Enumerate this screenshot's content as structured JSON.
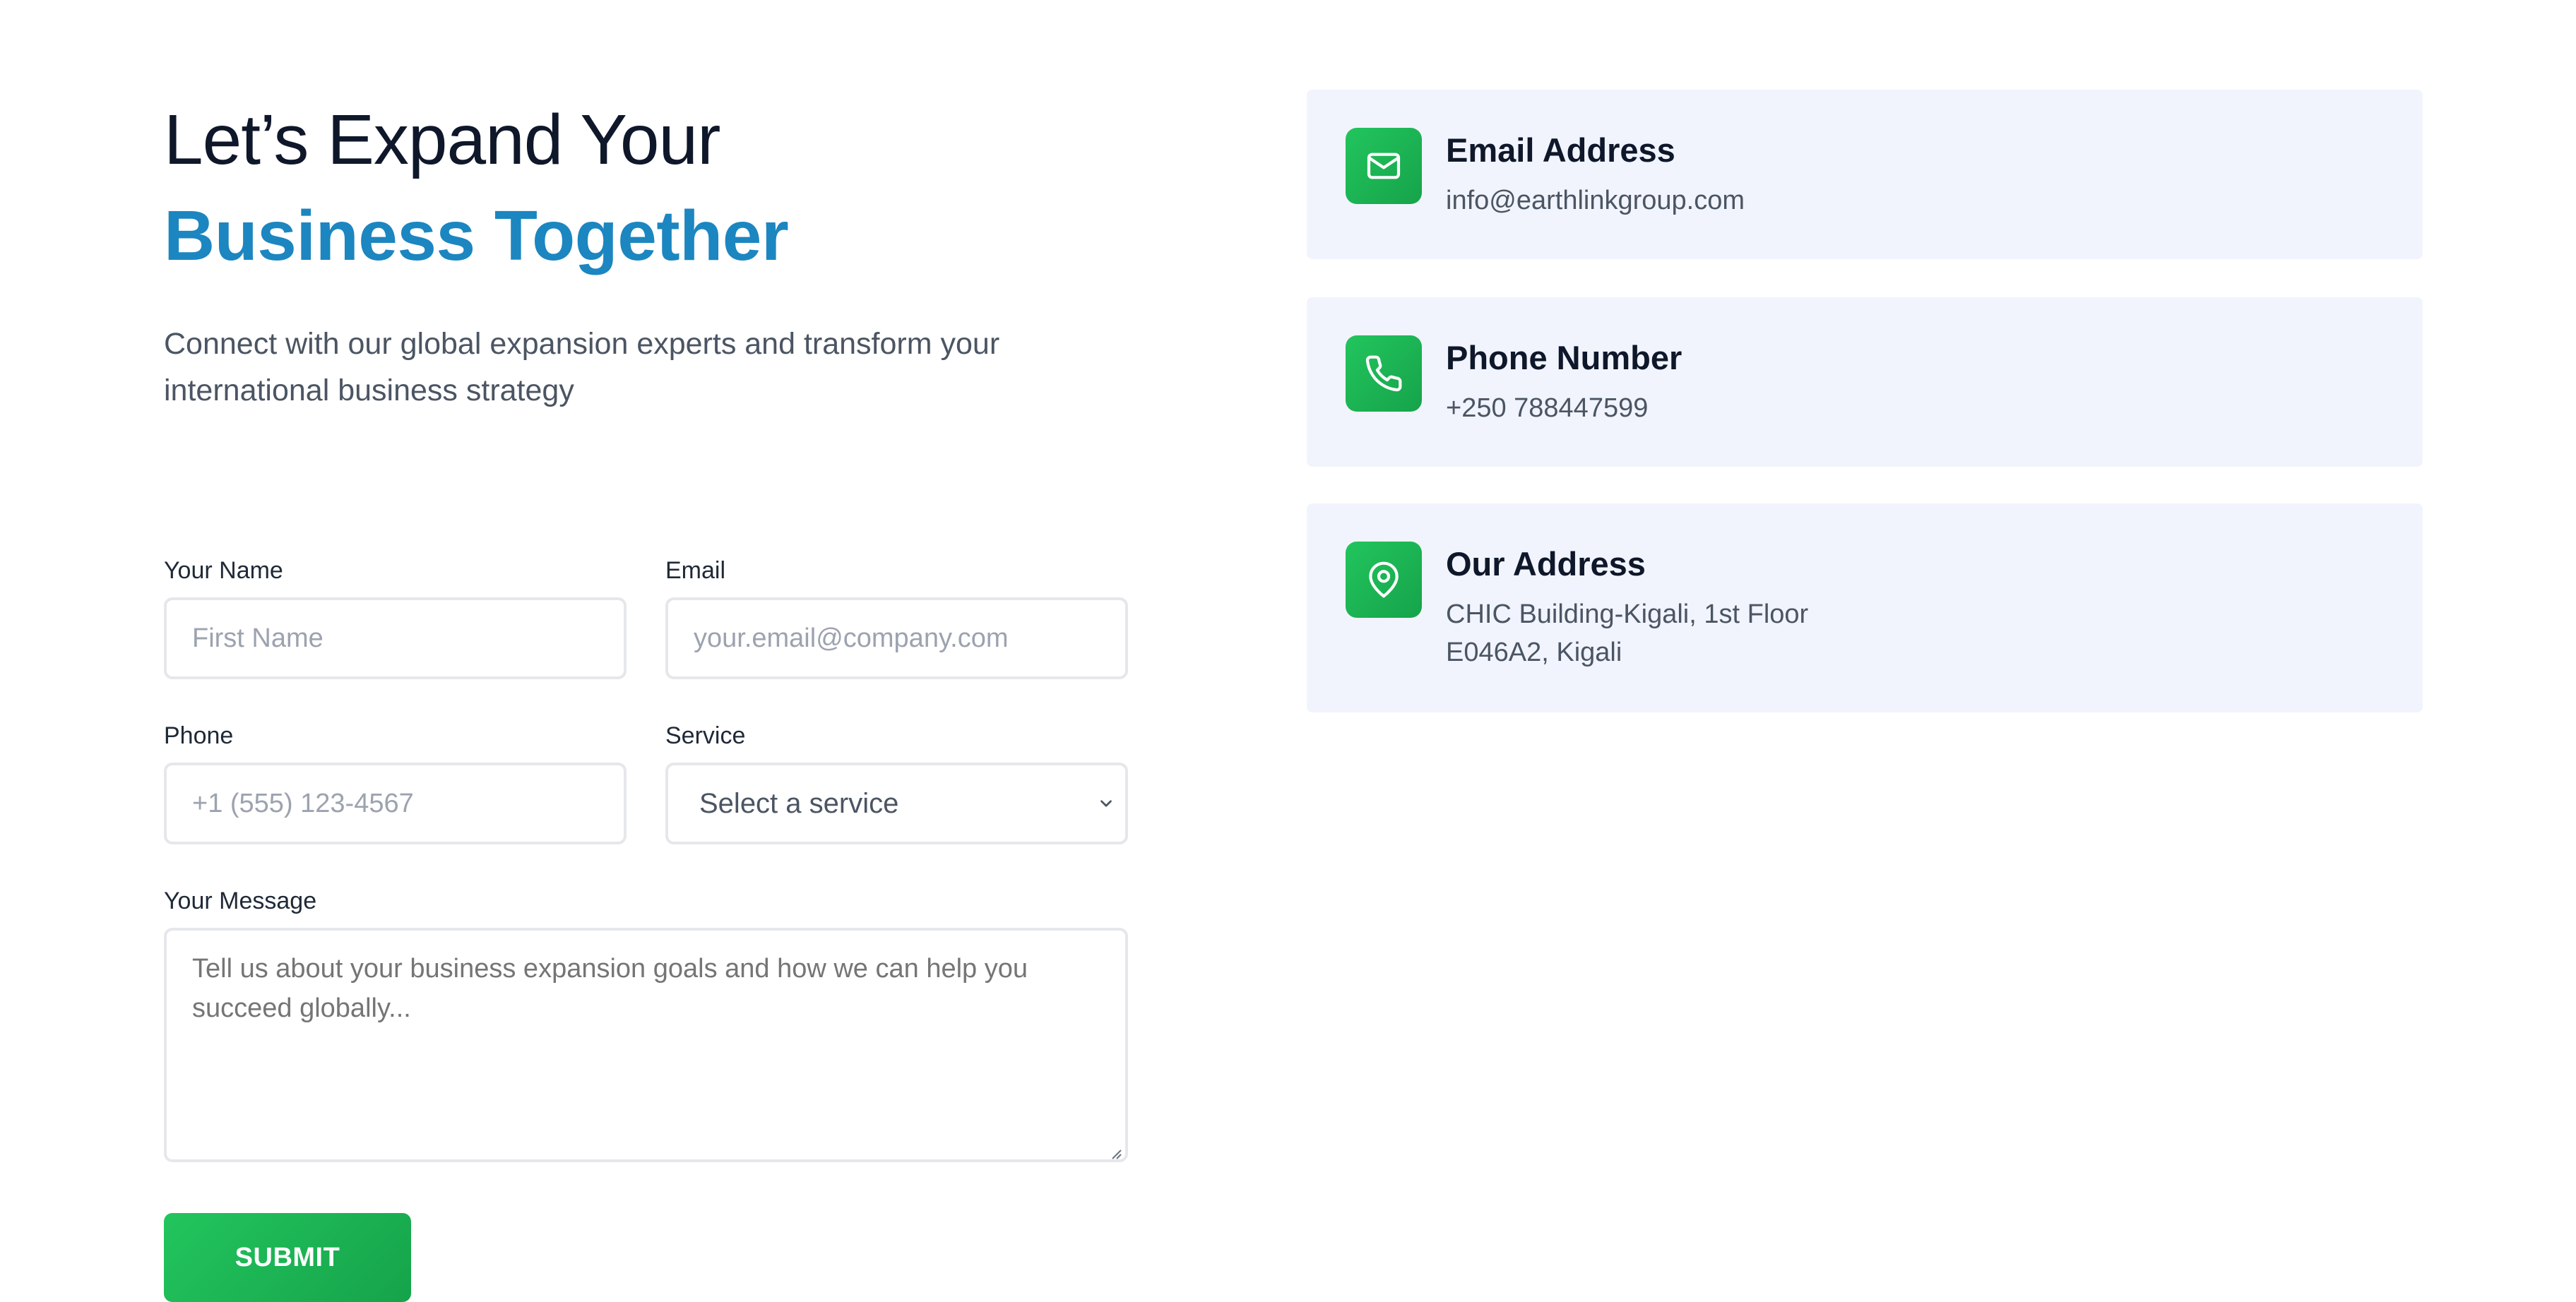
{
  "hero": {
    "title_line1": "Let’s Expand Your",
    "title_line2": "Business Together",
    "subtitle": "Connect with our global expansion experts and transform your international business strategy"
  },
  "form": {
    "name": {
      "label": "Your Name",
      "placeholder": "First Name"
    },
    "email": {
      "label": "Email",
      "placeholder": "your.email@company.com"
    },
    "phone": {
      "label": "Phone",
      "placeholder": "+1 (555) 123-4567"
    },
    "service": {
      "label": "Service",
      "selected": "Select a service"
    },
    "message": {
      "label": "Your Message",
      "placeholder": "Tell us about your business expansion goals and how we can help you succeed globally..."
    },
    "submit_label": "SUBMIT"
  },
  "contact_cards": [
    {
      "icon": "mail-icon",
      "title": "Email Address",
      "value": "info@earthlinkgroup.com"
    },
    {
      "icon": "phone-icon",
      "title": "Phone Number",
      "value": "+250 788447599"
    },
    {
      "icon": "map-pin-icon",
      "title": "Our Address",
      "value_line1": "CHIC Building-Kigali, 1st Floor",
      "value_line2": "E046A2, Kigali"
    }
  ],
  "colors": {
    "accent_blue": "#1c86c0",
    "accent_green": "#22c55e",
    "card_bg": "#f1f4fd"
  }
}
